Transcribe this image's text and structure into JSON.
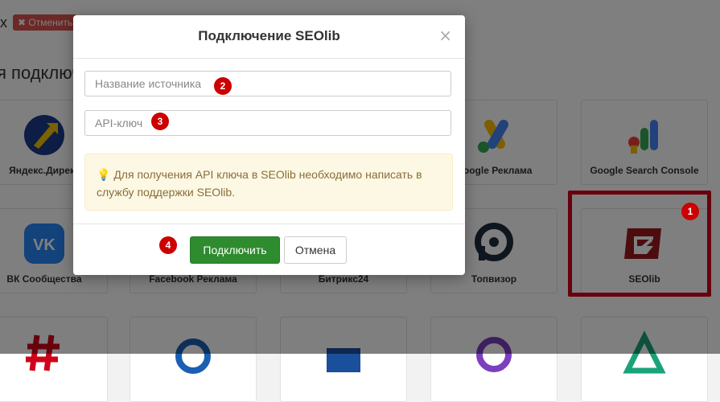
{
  "background": {
    "header_fragment": "х",
    "cancel_chip": "✖ Отменить",
    "section_title": "я подключ",
    "cards": [
      {
        "label": "Яндекс.Директ",
        "icon": "yandex-direct-icon"
      },
      {
        "label": "Google Реклама",
        "icon": "google-ads-icon"
      },
      {
        "label": "Google Search Console",
        "icon": "google-search-console-icon"
      },
      {
        "label": "ВК Сообщества",
        "icon": "vk-icon"
      },
      {
        "label": "Facebook Реклама",
        "icon": "facebook-icon"
      },
      {
        "label": "Битрикс24",
        "icon": "bitrix24-icon"
      },
      {
        "label": "Топвизор",
        "icon": "topvisor-icon"
      },
      {
        "label": "SEOlib",
        "icon": "seolib-icon"
      }
    ]
  },
  "modal": {
    "title": "Подключение SEOlib",
    "close": "×",
    "source_name_placeholder": "Название источника",
    "api_key_placeholder": "API-ключ",
    "info_icon": "lightbulb-icon",
    "info_text": "Для получения API ключа в SEOlib необходимо написать в службу поддержки SEOlib.",
    "connect_label": "Подключить",
    "cancel_label": "Отмена"
  },
  "annotations": [
    "1",
    "2",
    "3",
    "4"
  ],
  "colors": {
    "primary": "#2e8b2e",
    "alert_bg": "#fcf8e3",
    "alert_text": "#8a6d3b",
    "badge": "#c00000",
    "highlight": "#d0021b"
  }
}
